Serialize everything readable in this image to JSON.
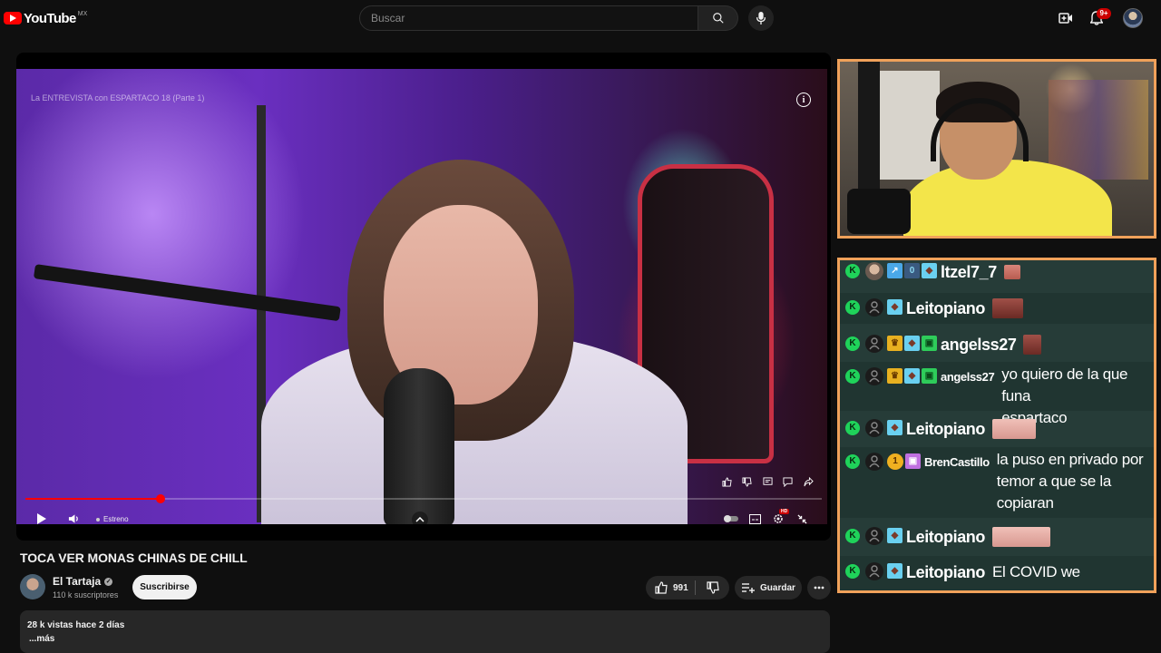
{
  "header": {
    "logo_text": "YouTube",
    "country": "MX",
    "search_placeholder": "Buscar",
    "notification_count": "9+"
  },
  "player": {
    "overlay_title": "La ENTREVISTA con ESPARTACO 18 (Parte 1)",
    "status_label": "Estreno",
    "progress_fraction": 0.17
  },
  "video": {
    "title": "TOCA VER MONAS CHINAS DE CHILL",
    "channel_name": "El Tartaja",
    "subscribers": "110 k suscriptores",
    "subscribe_label": "Suscribirse",
    "likes": "991",
    "save_label": "Guardar",
    "views_date": "28 k vistas  hace 2 días",
    "more_label": "...más"
  },
  "chat": {
    "messages": [
      {
        "user": "ltzel7_7",
        "text": ""
      },
      {
        "user": "Leitopiano",
        "text": ""
      },
      {
        "user": "angelss27",
        "text": ""
      },
      {
        "user": "angelss27",
        "text_line1": "yo quiero de la que funa",
        "text_line2": "espartaco"
      },
      {
        "user": "Leitopiano",
        "text": ""
      },
      {
        "user": "BrenCastillo",
        "coin": "1",
        "text_line1": "la puso en privado por",
        "text_line2": "temor a que se la",
        "text_line3": "copiaran"
      },
      {
        "user": "Leitopiano",
        "text": ""
      },
      {
        "user": "Leitopiano",
        "text": "El COVID we"
      }
    ]
  },
  "colors": {
    "brand_red": "#ff0000",
    "overlay_border": "#f0a15a",
    "chat_bg": "#263c38",
    "kick_green": "#1fd35a"
  }
}
